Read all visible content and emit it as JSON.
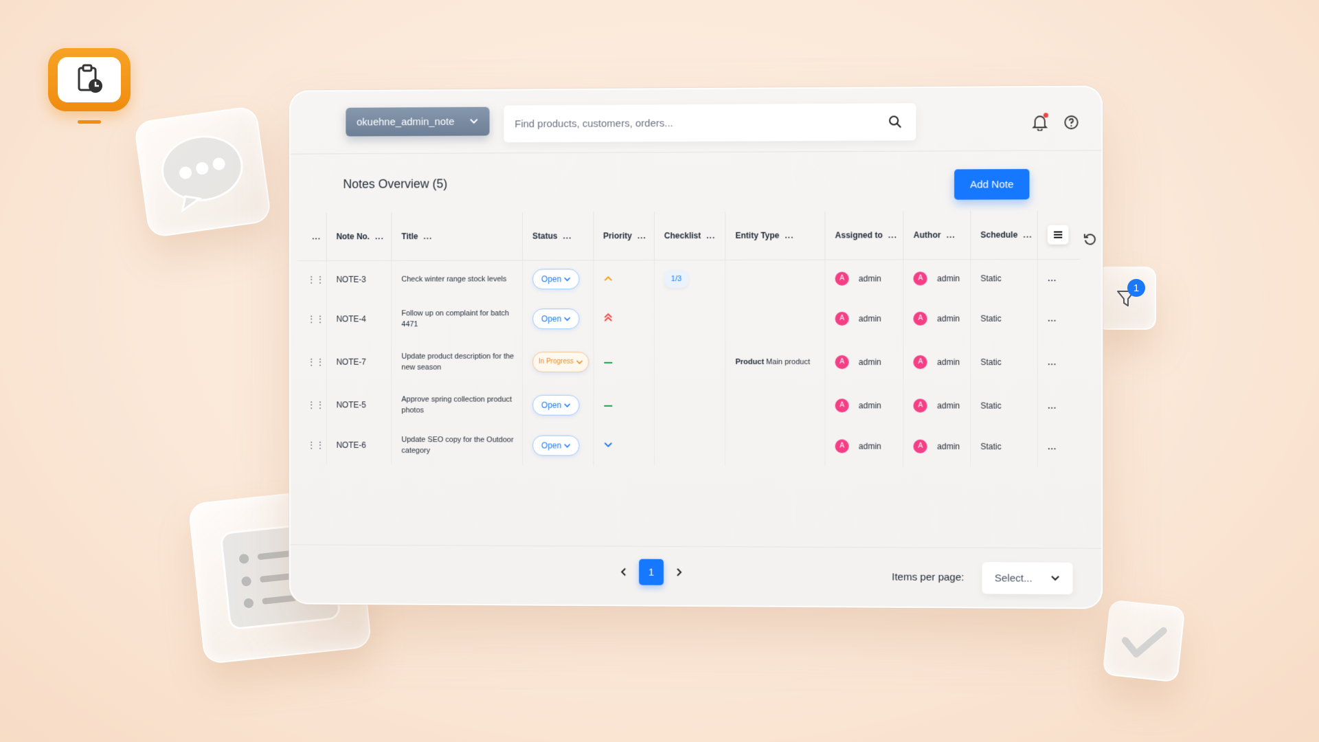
{
  "header": {
    "store_selector": "okuehne_admin_note",
    "search_placeholder": "Find products, customers, orders..."
  },
  "page": {
    "title": "Notes Overview (5)",
    "add_button": "Add Note"
  },
  "table": {
    "columns": [
      "Note No.",
      "Title",
      "Status",
      "Priority",
      "Checklist",
      "Entity Type",
      "Assigned to",
      "Author",
      "Schedule"
    ],
    "column_menu": "...",
    "rows": [
      {
        "note_no": "NOTE-3",
        "title": "Check winter range stock levels",
        "status": "Open",
        "priority": "chevron-up-icon",
        "checklist": "1/3",
        "entity_bold": "",
        "entity": "",
        "assigned_initial": "A",
        "assigned": "admin",
        "author_initial": "A",
        "author": "admin",
        "schedule": "Static"
      },
      {
        "note_no": "NOTE-4",
        "title": "Follow up on complaint for batch 4471",
        "status": "Open",
        "priority": "double-chevron-up-icon",
        "checklist": "",
        "entity_bold": "",
        "entity": "",
        "assigned_initial": "A",
        "assigned": "admin",
        "author_initial": "A",
        "author": "admin",
        "schedule": "Static"
      },
      {
        "note_no": "NOTE-7",
        "title": "Update product description for the new season",
        "status": "In Progress",
        "priority": "dash-icon",
        "checklist": "",
        "entity_bold": "Product",
        "entity": " Main product",
        "assigned_initial": "A",
        "assigned": "admin",
        "author_initial": "A",
        "author": "admin",
        "schedule": "Static"
      },
      {
        "note_no": "NOTE-5",
        "title": "Approve spring collection product photos",
        "status": "Open",
        "priority": "dash-icon",
        "checklist": "",
        "entity_bold": "",
        "entity": "",
        "assigned_initial": "A",
        "assigned": "admin",
        "author_initial": "A",
        "author": "admin",
        "schedule": "Static"
      },
      {
        "note_no": "NOTE-6",
        "title": "Update SEO copy for the Outdoor category",
        "status": "Open",
        "priority": "chevron-down-icon",
        "checklist": "",
        "entity_bold": "",
        "entity": "",
        "assigned_initial": "A",
        "assigned": "admin",
        "author_initial": "A",
        "author": "admin",
        "schedule": "Static"
      }
    ]
  },
  "filter": {
    "badge_count": "1"
  },
  "pagination": {
    "current_page": "1",
    "items_per_page_label": "Items per page:",
    "items_per_page_placeholder": "Select..."
  },
  "colors": {
    "accent": "#1677ff",
    "brand": "#f08c10",
    "priority_high": "#ef4444",
    "priority_medium": "#f59e0b",
    "priority_normal": "#16a34a",
    "priority_low": "#1677ff",
    "avatar": "#f43f86"
  }
}
